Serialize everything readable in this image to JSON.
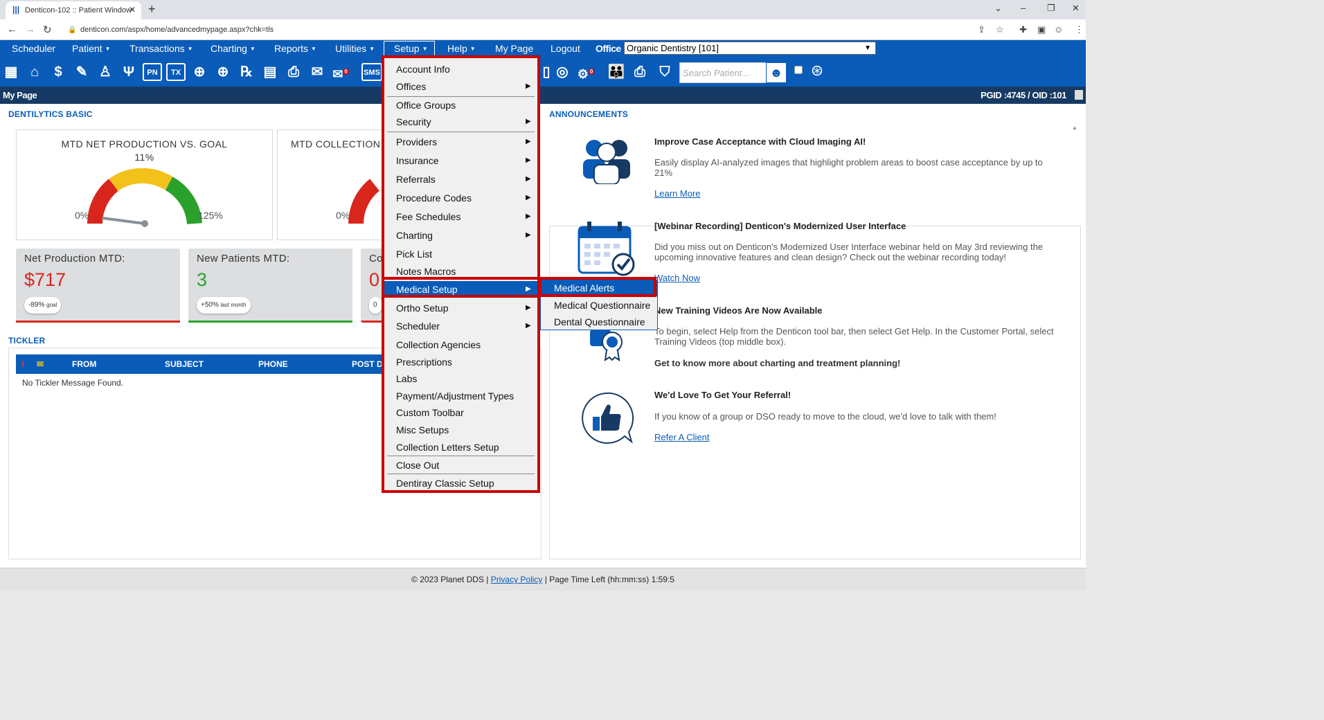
{
  "browser": {
    "tab_title": "Denticon-102 :: Patient Window",
    "url": "denticon.com/aspx/home/advancedmypage.aspx?chk=tls"
  },
  "menubar": {
    "items": [
      "Scheduler",
      "Patient",
      "Transactions",
      "Charting",
      "Reports",
      "Utilities",
      "Setup",
      "Help",
      "My Page",
      "Logout"
    ],
    "office_label": "Office",
    "office_value": "Organic Dentistry [101]"
  },
  "toolbar": {
    "box_labels": [
      "PN",
      "TX",
      "SMS"
    ],
    "badges": [
      "0",
      "0"
    ],
    "search_placeholder": "Search Patient..."
  },
  "titlestrip": {
    "page": "My Page",
    "ids": "PGID :4745  /  OID :101"
  },
  "dentilytics": {
    "heading": "DENTILYTICS BASIC",
    "gauge1": {
      "title": "MTD NET PRODUCTION VS. GOAL",
      "percent": "11%",
      "min": "0%",
      "max": "125%",
      "value_fraction": 0.088
    },
    "gauge2": {
      "title": "MTD COLLECTION",
      "min": "0%"
    },
    "kpis": [
      {
        "label": "Net Production MTD:",
        "value": "$717",
        "pill": "-89%",
        "pill_sub": "goal",
        "color": "#d9261c"
      },
      {
        "label": "New Patients MTD:",
        "value": "3",
        "pill": "+50%",
        "pill_sub": "last month",
        "color": "#2aa12a"
      },
      {
        "label": "Co",
        "value": "0",
        "pill": "0",
        "pill_sub": "",
        "color": "#d9261c"
      }
    ]
  },
  "tickler": {
    "heading": "TICKLER",
    "columns": [
      "FROM",
      "SUBJECT",
      "PHONE",
      "POST D"
    ],
    "empty": "No Tickler Message Found."
  },
  "announcements": {
    "heading": "ANNOUNCEMENTS",
    "items": [
      {
        "title": "Improve Case Acceptance with Cloud Imaging AI!",
        "desc": "Easily display AI-analyzed images that highlight problem areas to boost case acceptance by up to 21%",
        "link": "Learn More"
      },
      {
        "title": "[Webinar Recording] Denticon's Modernized User Interface",
        "desc": "Did you miss out on Denticon's Modernized User Interface webinar held on May 3rd reviewing the upcoming innovative features and clean design? Check out the webinar recording today!",
        "link": "Watch Now"
      },
      {
        "title": "New Training Videos Are Now Available",
        "desc": "To begin, select Help from the Denticon tool bar, then select Get Help. In the Customer Portal, select Training Videos (top middle box).",
        "extra": "Get to know more about charting and treatment planning!"
      },
      {
        "title": "We'd Love To Get Your Referral!",
        "desc": "If you know of a group or DSO ready to move to the cloud, we'd love to talk with them!",
        "link": "Refer A Client"
      }
    ]
  },
  "setup_menu": {
    "items": [
      {
        "label": "Account Info",
        "sub": false
      },
      {
        "label": "Offices",
        "sub": true
      },
      {
        "label": "Office Groups",
        "sub": false
      },
      {
        "label": "Security",
        "sub": true
      },
      {
        "label": "Providers",
        "sub": true
      },
      {
        "label": "Insurance",
        "sub": true
      },
      {
        "label": "Referrals",
        "sub": true
      },
      {
        "label": "Procedure Codes",
        "sub": true
      },
      {
        "label": "Fee Schedules",
        "sub": true
      },
      {
        "label": "Charting",
        "sub": true
      },
      {
        "label": "Pick List",
        "sub": false
      },
      {
        "label": "Notes Macros",
        "sub": false
      },
      {
        "label": "Medical Setup",
        "sub": true
      },
      {
        "label": "Ortho Setup",
        "sub": true
      },
      {
        "label": "Scheduler",
        "sub": true
      },
      {
        "label": "Collection Agencies",
        "sub": false
      },
      {
        "label": "Prescriptions",
        "sub": false
      },
      {
        "label": "Labs",
        "sub": false
      },
      {
        "label": "Payment/Adjustment Types",
        "sub": false
      },
      {
        "label": "Custom Toolbar",
        "sub": false
      },
      {
        "label": "Misc Setups",
        "sub": false
      },
      {
        "label": "Collection Letters Setup",
        "sub": false
      },
      {
        "label": "Close Out",
        "sub": false
      },
      {
        "label": "Dentiray Classic Setup",
        "sub": false
      }
    ]
  },
  "medical_submenu": {
    "items": [
      "Medical Alerts",
      "Medical Questionnaire",
      "Dental Questionnaire"
    ]
  },
  "footer": {
    "copyright": "© 2023 Planet DDS |",
    "privacy": "Privacy Policy",
    "time_left": "| Page Time Left (hh:mm:ss) 1:59:5"
  },
  "colors": {
    "brand": "#0a5cb8",
    "highlight_border": "#cc0000",
    "dark_strip": "#163a63"
  }
}
